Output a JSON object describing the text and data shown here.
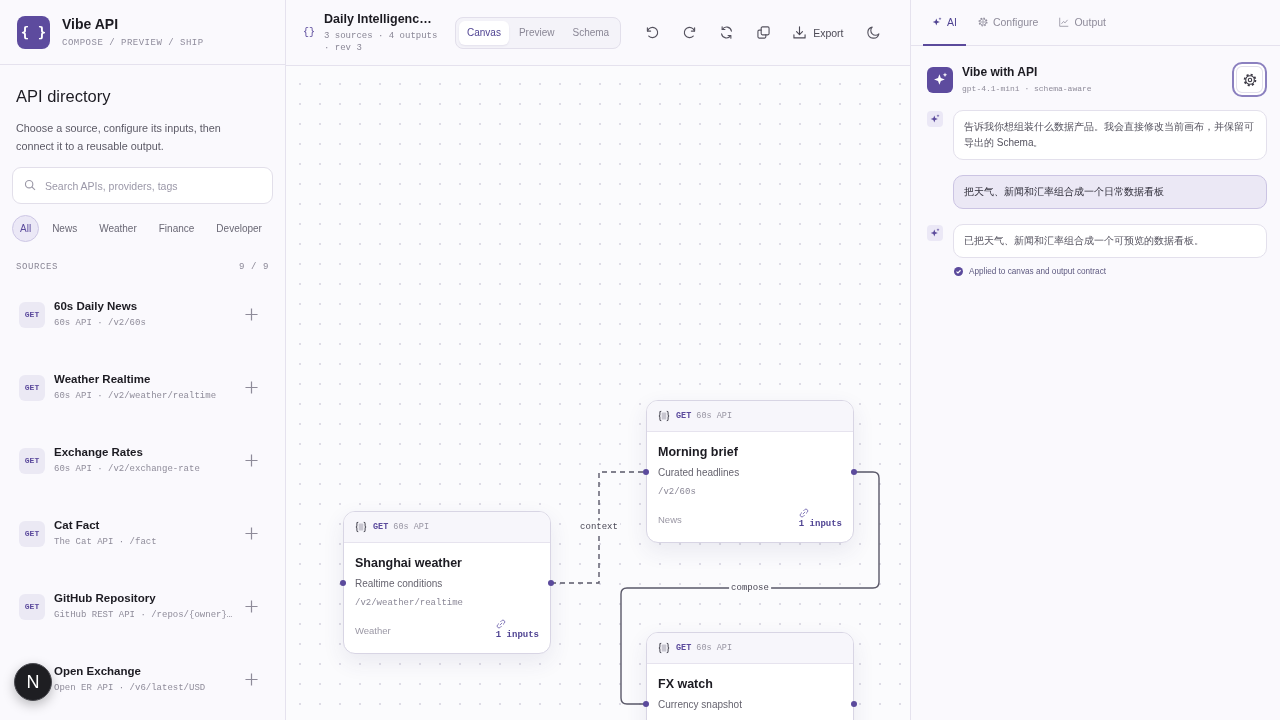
{
  "brand": {
    "logo": "{ }",
    "name": "Vibe API",
    "tagline": "COMPOSE / PREVIEW / SHIP"
  },
  "directory": {
    "title": "API directory",
    "description": "Choose a source, configure its inputs, then connect it to a reusable output.",
    "search": {
      "placeholder": "Search APIs, providers, tags"
    },
    "filters": [
      {
        "label": "All",
        "selected": true
      },
      {
        "label": "News",
        "selected": false
      },
      {
        "label": "Weather",
        "selected": false
      },
      {
        "label": "Finance",
        "selected": false
      },
      {
        "label": "Developer",
        "selected": false
      }
    ],
    "sources_label": "SOURCES",
    "sources_count": "9 / 9",
    "sources": [
      {
        "method": "GET",
        "name": "60s Daily News",
        "detail": "60s API · /v2/60s"
      },
      {
        "method": "GET",
        "name": "Weather Realtime",
        "detail": "60s API · /v2/weather/realtime"
      },
      {
        "method": "GET",
        "name": "Exchange Rates",
        "detail": "60s API · /v2/exchange-rate"
      },
      {
        "method": "GET",
        "name": "Cat Fact",
        "detail": "The Cat API · /fact"
      },
      {
        "method": "GET",
        "name": "GitHub Repository",
        "detail": "GitHub REST API · /repos/{owner}…"
      },
      {
        "name": "Open Exchange",
        "detail": "Open ER API · /v6/latest/USD"
      }
    ]
  },
  "document": {
    "icon": "{}",
    "title": "Daily Intelligenc…",
    "meta": "3 sources · 4 outputs · rev 3"
  },
  "view_tabs": [
    {
      "label": "Canvas",
      "selected": true
    },
    {
      "label": "Preview",
      "selected": false
    },
    {
      "label": "Schema",
      "selected": false
    }
  ],
  "toolbar": {
    "export": "Export"
  },
  "canvas": {
    "nodes": [
      {
        "method": "GET",
        "provider": "60s API",
        "title": "Morning brief",
        "subtitle": "Curated headlines",
        "path": "/v2/60s",
        "tag": "News",
        "inputs": "1 inputs"
      },
      {
        "method": "GET",
        "provider": "60s API",
        "title": "Shanghai weather",
        "subtitle": "Realtime conditions",
        "path": "/v2/weather/realtime",
        "tag": "Weather",
        "inputs": "1 inputs"
      },
      {
        "method": "GET",
        "provider": "60s API",
        "title": "FX watch",
        "subtitle": "Currency snapshot"
      }
    ],
    "edges": [
      {
        "label": "context",
        "kind": "dashed"
      },
      {
        "label": "compose",
        "kind": "solid"
      }
    ]
  },
  "assistant": {
    "tabs": [
      {
        "label": "AI",
        "selected": true
      },
      {
        "label": "Configure",
        "selected": false
      },
      {
        "label": "Output",
        "selected": false
      }
    ],
    "title": "Vibe with API",
    "model": "gpt-4.1-mini · schema-aware",
    "messages": [
      {
        "kind": "assistant",
        "text": "告诉我你想组装什么数据产品。我会直接修改当前画布，并保留可导出的 Schema。"
      },
      {
        "kind": "user",
        "text": "把天气、新闻和汇率组合成一个日常数据看板"
      },
      {
        "kind": "assistant",
        "text": "已把天气、新闻和汇率组合成一个可预览的数据看板。"
      }
    ],
    "status": "Applied to canvas and output contract"
  },
  "dev_badge": "N"
}
